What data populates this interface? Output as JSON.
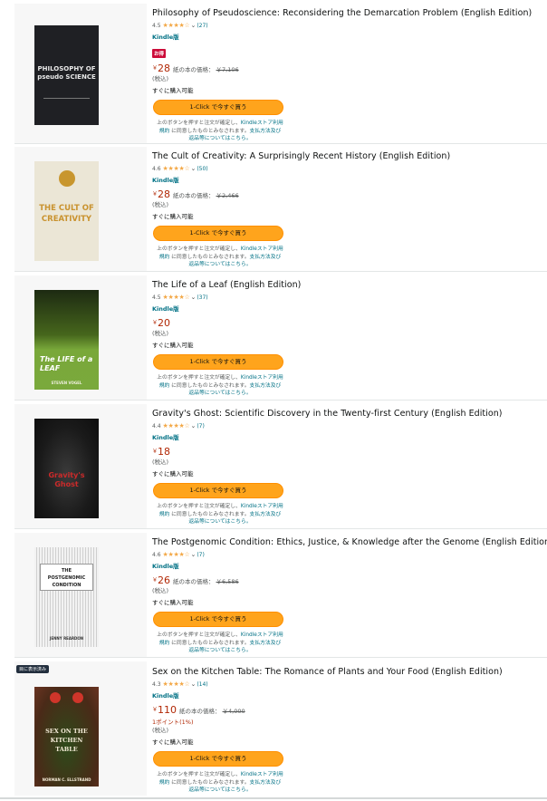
{
  "books": [
    {
      "title": "Philosophy of Pseudoscience: Reconsidering the Demarcation Problem (English Edition)",
      "rating": "4.5",
      "stars": "★★★★☆",
      "count": "(27)",
      "format": "Kindle版",
      "badge": "お得",
      "yen": "￥",
      "price": "28",
      "paper_label": "紙の本の価格：",
      "paper_price": "￥7,106",
      "tax": "(税込)",
      "availability": "すぐに購入可能",
      "button": "1-Click で今すぐ買う",
      "notice1": "上のボタンを押すと注文が確定し、",
      "notice_link1": "Kindleストア利用",
      "notice2": "規約",
      "notice3": " に同意したものとみなされます。",
      "notice_link2": "支払方法及び",
      "notice4": "返品等についてはこちら。",
      "cover": {
        "title": "PHILOSOPHY OF pseudo SCIENCE"
      }
    },
    {
      "title": "The Cult of Creativity: A Surprisingly Recent History (English Edition)",
      "rating": "4.6",
      "stars": "★★★★☆",
      "count": "(50)",
      "format": "Kindle版",
      "yen": "￥",
      "price": "28",
      "paper_label": "紙の本の価格：",
      "paper_price": "￥2,466",
      "tax": "(税込)",
      "availability": "すぐに購入可能",
      "button": "1-Click で今すぐ買う",
      "notice1": "上のボタンを押すと注文が確定し、",
      "notice_link1": "Kindleストア利用",
      "notice2": "規約",
      "notice3": " に同意したものとみなされます。",
      "notice_link2": "支払方法及び",
      "notice4": "返品等についてはこちら。",
      "cover": {
        "title": "THE CULT OF CREATIVITY"
      }
    },
    {
      "title": "The Life of a Leaf (English Edition)",
      "rating": "4.5",
      "stars": "★★★★☆",
      "count": "(37)",
      "format": "Kindle版",
      "yen": "￥",
      "price": "20",
      "tax": "(税込)",
      "availability": "すぐに購入可能",
      "button": "1-Click で今すぐ買う",
      "notice1": "上のボタンを押すと注文が確定し、",
      "notice_link1": "Kindleストア利用",
      "notice2": "規約",
      "notice3": " に同意したものとみなされます。",
      "notice_link2": "支払方法及び",
      "notice4": "返品等についてはこちら。",
      "cover": {
        "title": "The LIFE of a LEAF",
        "author": "STEVEN VOGEL"
      }
    },
    {
      "title": "Gravity's Ghost: Scientific Discovery in the Twenty-first Century (English Edition)",
      "rating": "4.4",
      "stars": "★★★★☆",
      "count": "(7)",
      "format": "Kindle版",
      "yen": "￥",
      "price": "18",
      "tax": "(税込)",
      "availability": "すぐに購入可能",
      "button": "1-Click で今すぐ買う",
      "notice1": "上のボタンを押すと注文が確定し、",
      "notice_link1": "Kindleストア利用",
      "notice2": "規約",
      "notice3": " に同意したものとみなされます。",
      "notice_link2": "支払方法及び",
      "notice4": "返品等についてはこちら。",
      "cover": {
        "title": "Gravity's Ghost"
      }
    },
    {
      "title": "The Postgenomic Condition: Ethics, Justice, & Knowledge after the Genome (English Edition)",
      "rating": "4.6",
      "stars": "★★★★☆",
      "count": "(7)",
      "format": "Kindle版",
      "yen": "￥",
      "price": "26",
      "paper_label": "紙の本の価格：",
      "paper_price": "￥6,586",
      "tax": "(税込)",
      "availability": "すぐに購入可能",
      "button": "1-Click で今すぐ買う",
      "notice1": "上のボタンを押すと注文が確定し、",
      "notice_link1": "Kindleストア利用",
      "notice2": "規約",
      "notice3": " に同意したものとみなされます。",
      "notice_link2": "支払方法及び",
      "notice4": "返品等についてはこちら。",
      "cover": {
        "title": "THE POSTGENOMIC CONDITION",
        "author": "JENNY REARDON"
      }
    },
    {
      "title": "Sex on the Kitchen Table: The Romance of Plants and Your Food (English Edition)",
      "rating": "4.3",
      "stars": "★★★★☆",
      "count": "(14)",
      "format": "Kindle版",
      "yen": "￥",
      "price": "110",
      "paper_label": "紙の本の価格：",
      "paper_price": "￥4,000",
      "points": "1ポイント(1%)",
      "tax": "(税込)",
      "availability": "すぐに購入可能",
      "button": "1-Click で今すぐ買う",
      "notice1": "上のボタンを押すと注文が確定し、",
      "notice_link1": "Kindleストア利用",
      "notice2": "規約",
      "notice3": " に同意したものとみなされます。",
      "notice_link2": "支払方法及び",
      "notice4": "返品等についてはこちら。",
      "read_tag": "目に表示済み",
      "cover": {
        "title": "SEX ON THE KITCHEN TABLE",
        "author": "NORMAN C. ELLSTRAND"
      }
    }
  ]
}
